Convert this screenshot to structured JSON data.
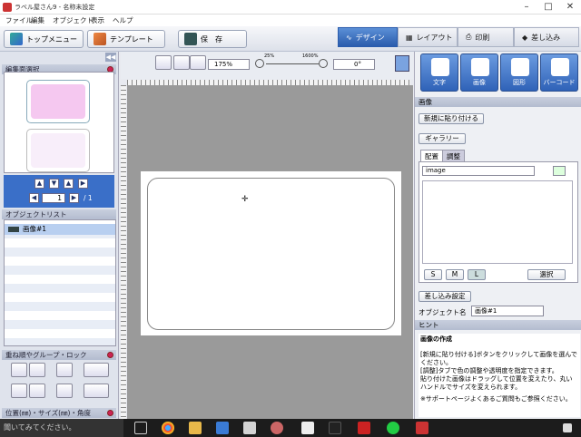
{
  "window": {
    "title": "ラベル屋さん9 - 名称未設定"
  },
  "menu": [
    "ファイル",
    "編集",
    "オブジェクト",
    "表示",
    "ヘルプ"
  ],
  "toolbar": {
    "top_menu": "トップメニュー",
    "template": "テンプレート",
    "save": "保　存"
  },
  "mode_tabs": [
    {
      "label": "デザイン",
      "active": true
    },
    {
      "label": "レイアウト"
    },
    {
      "label": "印刷"
    },
    {
      "label": "差し込み"
    }
  ],
  "left": {
    "edit_select": "編集面選択",
    "page_current": "1",
    "page_total": "/ 1",
    "object_list": "オブジェクトリスト",
    "objects": [
      {
        "name": "画像#1"
      }
    ],
    "order_title": "重ね順やグループ・ロック",
    "position_title": "位置(㎜)・サイズ(㎜)・角度"
  },
  "canvas": {
    "zoom": "175%",
    "zoom_min": "25%",
    "zoom_max": "1600%",
    "rotation": "0°"
  },
  "right": {
    "tools": [
      "文字",
      "画像",
      "図形",
      "バーコード"
    ],
    "section": "画像",
    "paste_new": "新規に貼り付ける",
    "gallery": "ギャラリー",
    "tabs": [
      "配置",
      "調整"
    ],
    "dropdown": "image",
    "sizes": [
      "S",
      "M",
      "L"
    ],
    "select": "選択",
    "merge_setting": "差し込み設定",
    "object_name_label": "オブジェクト名",
    "object_name_value": "画像#1",
    "hint_label": "ヒント",
    "hint_title": "画像の作成",
    "hint_lines": [
      "[新規に貼り付ける]ボタンをクリックして画像を選んでください。",
      "[調整]タブで色の調整や透明度を指定できます。",
      "貼り付けた画像はドラッグして位置を変えたり、丸いハンドルでサイズを変えられます。",
      "※サポートページよくあるご質問もご参照ください。"
    ]
  },
  "taskbar": {
    "search": "聞いてみてください。"
  },
  "colors": {
    "accent": "#2a5cad",
    "thumb_top": "#f5c8f0",
    "thumb_bottom": "#f8eefa"
  }
}
